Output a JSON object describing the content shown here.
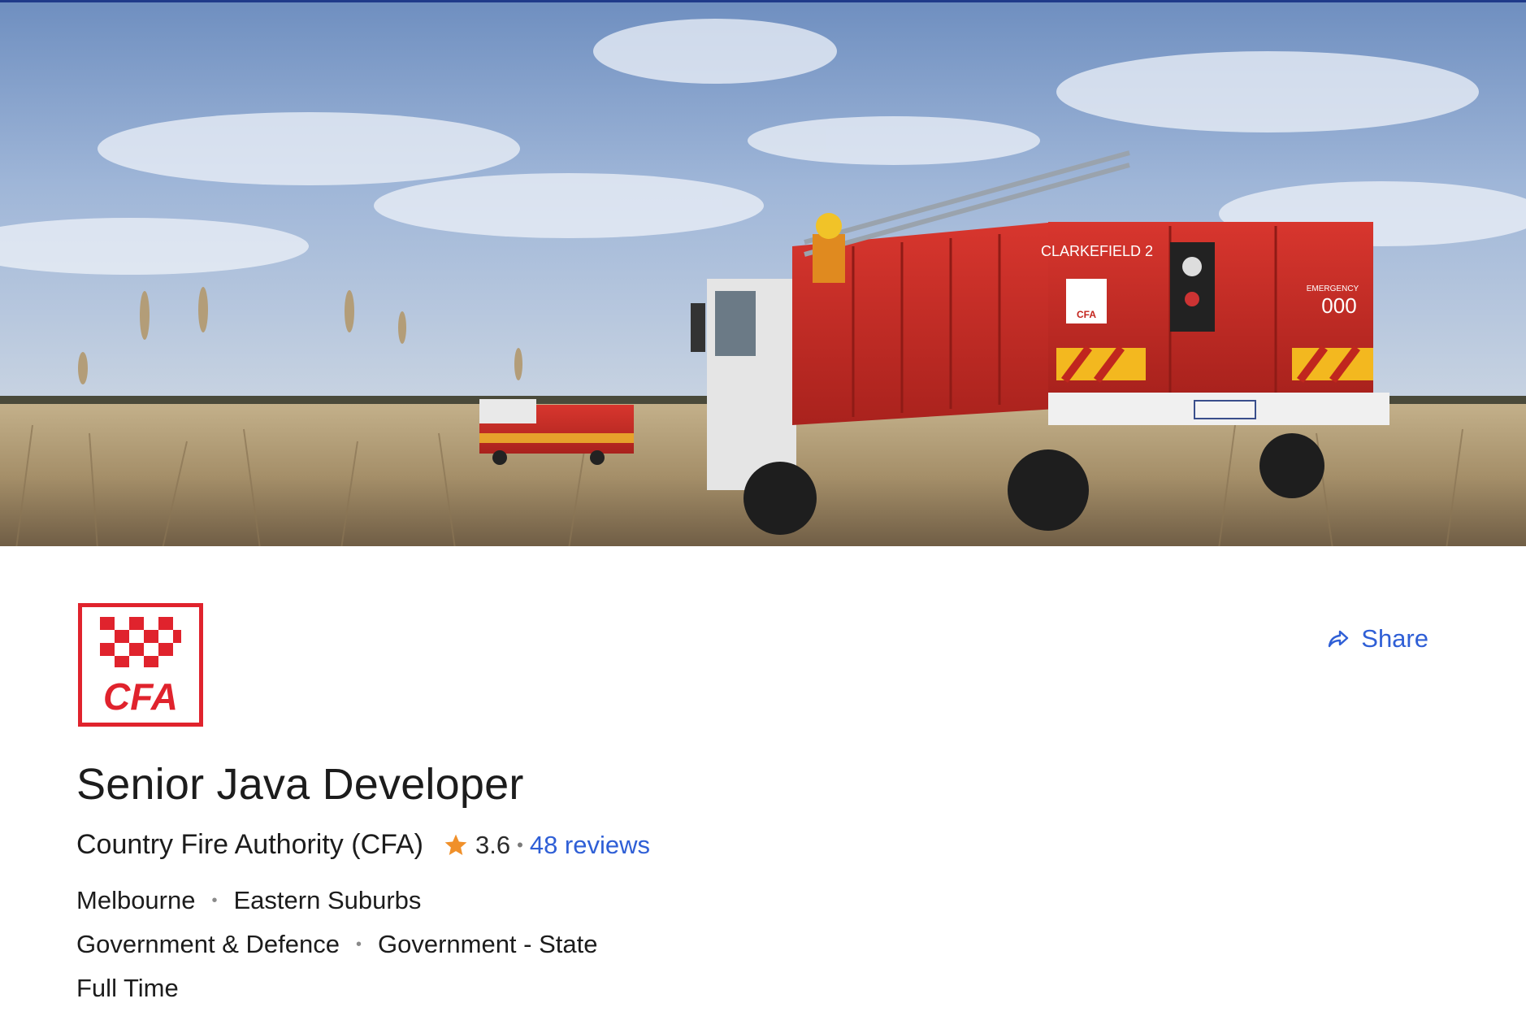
{
  "banner": {
    "truck_text": "CLARKEFIELD 2",
    "emergency_label": "EMERGENCY",
    "emergency_number": "000",
    "badge": "CFA"
  },
  "logo": {
    "text": "CFA",
    "color": "#e0232d"
  },
  "share": {
    "label": "Share",
    "icon": "share-arrow-icon"
  },
  "job": {
    "title": "Senior Java Developer",
    "company": "Country Fire Authority (CFA)",
    "rating": "3.6",
    "rating_separator": "•",
    "reviews": "48 reviews",
    "location": "Melbourne",
    "area": "Eastern Suburbs",
    "classification": "Government & Defence",
    "subclassification": "Government - State",
    "work_type": "Full Time",
    "meta_separator": "•"
  },
  "colors": {
    "accent": "#2f5fd6",
    "star": "#f0902a",
    "brand_red": "#e0232d"
  }
}
